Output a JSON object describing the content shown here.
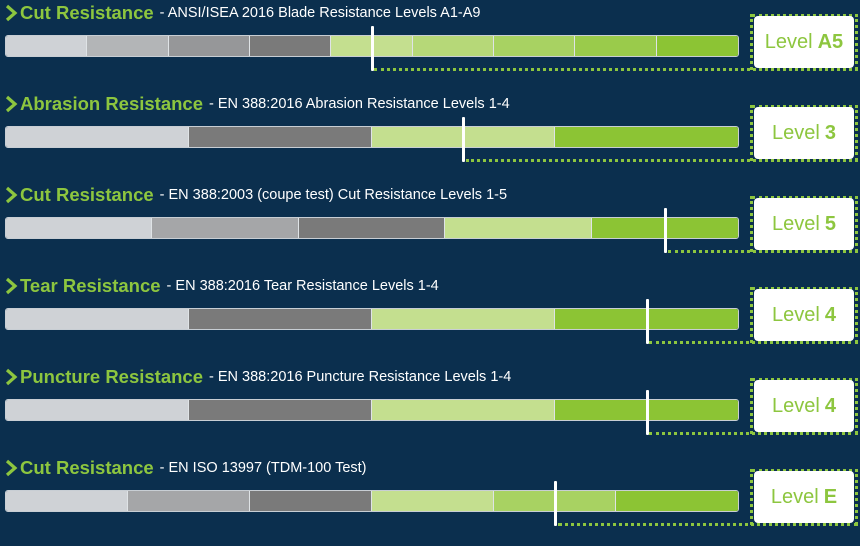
{
  "chart_data": [
    {
      "type": "bar",
      "name": "Cut Resistance",
      "standard": "ANSI/ISEA 2016 Blade Resistance Levels A1-A9",
      "levels": [
        "A1",
        "A2",
        "A3",
        "A4",
        "A5",
        "A6",
        "A7",
        "A8",
        "A9"
      ],
      "value": 5,
      "badge_prefix": "Level",
      "badge_value": "A5"
    },
    {
      "type": "bar",
      "name": "Abrasion Resistance",
      "standard": "EN 388:2016 Abrasion Resistance Levels 1-4",
      "levels": [
        "1",
        "2",
        "3",
        "4"
      ],
      "value": 3,
      "badge_prefix": "Level",
      "badge_value": "3"
    },
    {
      "type": "bar",
      "name": "Cut Resistance",
      "standard": "EN 388:2003 (coupe test) Cut Resistance Levels 1-5",
      "levels": [
        "1",
        "2",
        "3",
        "4",
        "5"
      ],
      "value": 5,
      "badge_prefix": "Level",
      "badge_value": "5"
    },
    {
      "type": "bar",
      "name": "Tear Resistance",
      "standard": "EN 388:2016 Tear Resistance Levels 1-4",
      "levels": [
        "1",
        "2",
        "3",
        "4"
      ],
      "value": 4,
      "badge_prefix": "Level",
      "badge_value": "4"
    },
    {
      "type": "bar",
      "name": "Puncture Resistance",
      "standard": "EN 388:2016 Puncture Resistance Levels 1-4",
      "levels": [
        "1",
        "2",
        "3",
        "4"
      ],
      "value": 4,
      "badge_prefix": "Level",
      "badge_value": "4"
    },
    {
      "type": "bar",
      "name": "Cut Resistance",
      "standard": "EN ISO 13997 (TDM-100 Test)",
      "levels": [
        "A",
        "B",
        "C",
        "D",
        "E",
        "F"
      ],
      "value": 5,
      "badge_prefix": "Level",
      "badge_value": "E"
    }
  ],
  "colors": {
    "background": "#0b2f4e",
    "accent": "#8dc63f",
    "grey_light": "#cfd2d6",
    "grey_dark": "#7a7a7a",
    "green_light": "#c4df8f",
    "green_dark": "#8cc434"
  },
  "icons": {
    "row_bullet": "chevron-right-icon"
  }
}
